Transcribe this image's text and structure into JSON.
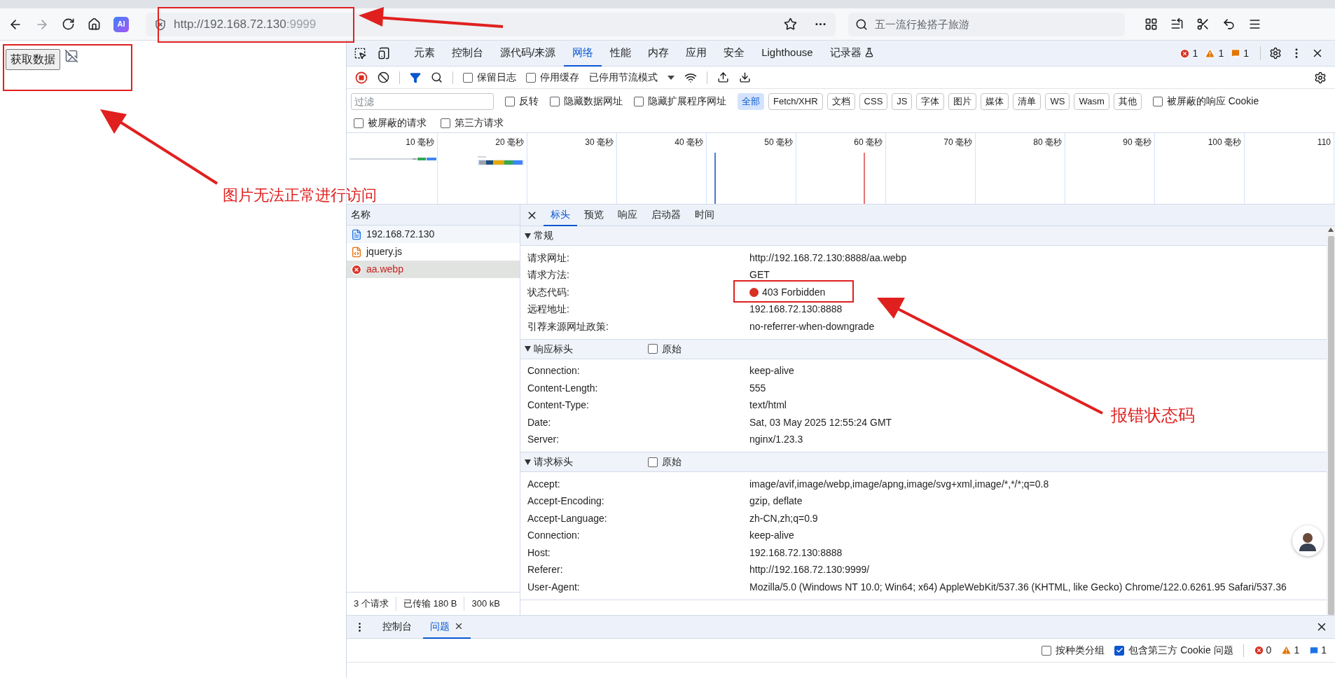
{
  "browser": {
    "address": {
      "host": "http://192.168.72.130",
      "port": ":9999"
    },
    "ai_badge": "AI",
    "search": {
      "placeholder": "五一流行捡搭子旅游"
    }
  },
  "page": {
    "button": "获取数据"
  },
  "devtools": {
    "tabs": [
      {
        "label": "元素",
        "selected": false
      },
      {
        "label": "控制台",
        "selected": false
      },
      {
        "label": "源代码/来源",
        "selected": false
      },
      {
        "label": "网络",
        "selected": true
      },
      {
        "label": "性能",
        "selected": false
      },
      {
        "label": "内存",
        "selected": false
      },
      {
        "label": "应用",
        "selected": false
      },
      {
        "label": "安全",
        "selected": false
      },
      {
        "label": "Lighthouse",
        "selected": false
      },
      {
        "label": "记录器",
        "selected": false
      }
    ],
    "counts": [
      {
        "kind": "error",
        "count": "1"
      },
      {
        "kind": "warning",
        "count": "1"
      },
      {
        "kind": "issue",
        "count": "1"
      }
    ],
    "toolbar": {
      "checks": [
        {
          "label": "保留日志",
          "checked": false
        },
        {
          "label": "停用缓存",
          "checked": false
        }
      ],
      "throttle": "已停用节流模式"
    },
    "filter": {
      "placeholder": "过滤",
      "checks": [
        {
          "label": "反转",
          "checked": false
        },
        {
          "label": "隐藏数据网址",
          "checked": false
        },
        {
          "label": "隐藏扩展程序网址",
          "checked": false
        }
      ],
      "types": [
        {
          "label": "全部",
          "selected": true
        },
        {
          "label": "Fetch/XHR",
          "selected": false
        },
        {
          "label": "文档",
          "selected": false
        },
        {
          "label": "CSS",
          "selected": false
        },
        {
          "label": "JS",
          "selected": false
        },
        {
          "label": "字体",
          "selected": false
        },
        {
          "label": "图片",
          "selected": false
        },
        {
          "label": "媒体",
          "selected": false
        },
        {
          "label": "清单",
          "selected": false
        },
        {
          "label": "WS",
          "selected": false
        },
        {
          "label": "Wasm",
          "selected": false
        },
        {
          "label": "其他",
          "selected": false
        }
      ],
      "blocked_responses": {
        "label": "被屏蔽的响应 Cookie",
        "checked": false
      },
      "more_checks": [
        {
          "label": "被屏蔽的请求",
          "checked": false
        },
        {
          "label": "第三方请求",
          "checked": false
        }
      ]
    },
    "timeline": {
      "ticks": [
        "10 毫秒",
        "20 毫秒",
        "30 毫秒",
        "40 毫秒",
        "50 毫秒",
        "60 毫秒",
        "70 毫秒",
        "80 毫秒",
        "90 毫秒",
        "100 毫秒",
        "110"
      ]
    },
    "requests": {
      "column": "名称",
      "items": [
        {
          "name": "192.168.72.130",
          "kind": "document",
          "selected": false
        },
        {
          "name": "jquery.js",
          "kind": "script",
          "selected": false
        },
        {
          "name": "aa.webp",
          "kind": "error",
          "selected": true
        }
      ],
      "summary": [
        "3 个请求",
        "已传输 180 B",
        "300 kB"
      ]
    },
    "detail_tabs": [
      {
        "label": "标头",
        "selected": true
      },
      {
        "label": "预览",
        "selected": false
      },
      {
        "label": "响应",
        "selected": false
      },
      {
        "label": "启动器",
        "selected": false
      },
      {
        "label": "时间",
        "selected": false
      }
    ],
    "sections": [
      {
        "title": "常规",
        "expanded": true,
        "rows": [
          {
            "name": "请求网址:",
            "value": "http://192.168.72.130:8888/aa.webp"
          },
          {
            "name": "请求方法:",
            "value": "GET"
          },
          {
            "name": "状态代码:",
            "value": "403 Forbidden",
            "kind": "status",
            "color": "#d93025"
          },
          {
            "name": "远程地址:",
            "value": "192.168.72.130:8888"
          },
          {
            "name": "引荐来源网址政策:",
            "value": "no-referrer-when-downgrade"
          }
        ]
      },
      {
        "title": "响应标头",
        "expanded": true,
        "raw": {
          "label": "原始",
          "checked": false
        },
        "rows": [
          {
            "name": "Connection:",
            "value": "keep-alive"
          },
          {
            "name": "Content-Length:",
            "value": "555"
          },
          {
            "name": "Content-Type:",
            "value": "text/html"
          },
          {
            "name": "Date:",
            "value": "Sat, 03 May 2025 12:55:24 GMT"
          },
          {
            "name": "Server:",
            "value": "nginx/1.23.3"
          }
        ]
      },
      {
        "title": "请求标头",
        "expanded": true,
        "raw": {
          "label": "原始",
          "checked": false
        },
        "rows": [
          {
            "name": "Accept:",
            "value": "image/avif,image/webp,image/apng,image/svg+xml,image/*,*/*;q=0.8"
          },
          {
            "name": "Accept-Encoding:",
            "value": "gzip, deflate"
          },
          {
            "name": "Accept-Language:",
            "value": "zh-CN,zh;q=0.9"
          },
          {
            "name": "Connection:",
            "value": "keep-alive"
          },
          {
            "name": "Host:",
            "value": "192.168.72.130:8888"
          },
          {
            "name": "Referer:",
            "value": "http://192.168.72.130:9999/"
          },
          {
            "name": "User-Agent:",
            "value": "Mozilla/5.0 (Windows NT 10.0; Win64; x64) AppleWebKit/537.36 (KHTML, like Gecko) Chrome/122.0.6261.95 Safari/537.36"
          }
        ]
      }
    ],
    "drawer": {
      "tabs": [
        {
          "label": "控制台",
          "selected": false
        },
        {
          "label": "问题",
          "selected": true
        }
      ],
      "checks": [
        {
          "label": "按种类分组",
          "checked": false
        },
        {
          "label": "包含第三方 Cookie 问题",
          "checked": true
        }
      ],
      "counts": [
        {
          "kind": "error",
          "count": "0"
        },
        {
          "kind": "warning",
          "count": "1"
        },
        {
          "kind": "info",
          "count": "1"
        }
      ]
    }
  },
  "annotations": [
    {
      "text": "图片无法正常进行访问"
    },
    {
      "text": "报错状态码"
    }
  ]
}
